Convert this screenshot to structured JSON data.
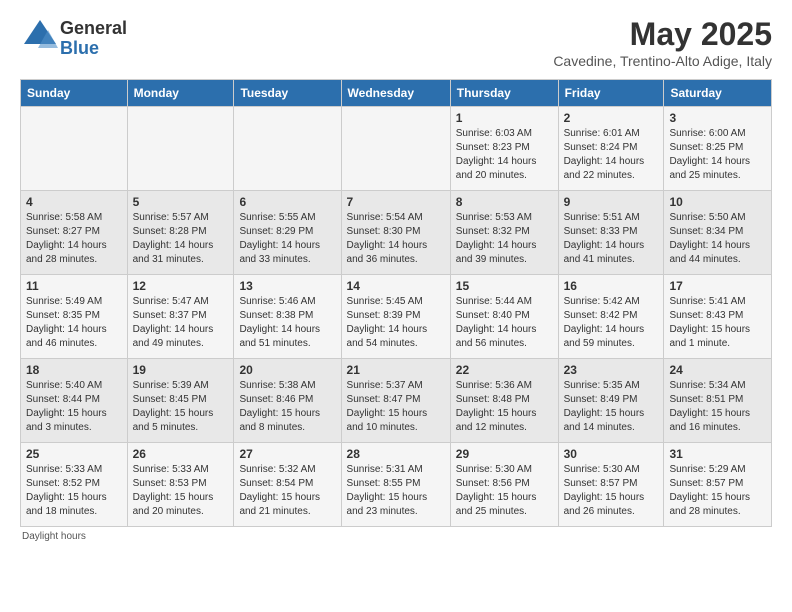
{
  "logo": {
    "general": "General",
    "blue": "Blue"
  },
  "title": "May 2025",
  "subtitle": "Cavedine, Trentino-Alto Adige, Italy",
  "days_of_week": [
    "Sunday",
    "Monday",
    "Tuesday",
    "Wednesday",
    "Thursday",
    "Friday",
    "Saturday"
  ],
  "footer_note": "Daylight hours",
  "weeks": [
    [
      {
        "day": "",
        "info": ""
      },
      {
        "day": "",
        "info": ""
      },
      {
        "day": "",
        "info": ""
      },
      {
        "day": "",
        "info": ""
      },
      {
        "day": "1",
        "info": "Sunrise: 6:03 AM\nSunset: 8:23 PM\nDaylight: 14 hours\nand 20 minutes."
      },
      {
        "day": "2",
        "info": "Sunrise: 6:01 AM\nSunset: 8:24 PM\nDaylight: 14 hours\nand 22 minutes."
      },
      {
        "day": "3",
        "info": "Sunrise: 6:00 AM\nSunset: 8:25 PM\nDaylight: 14 hours\nand 25 minutes."
      }
    ],
    [
      {
        "day": "4",
        "info": "Sunrise: 5:58 AM\nSunset: 8:27 PM\nDaylight: 14 hours\nand 28 minutes."
      },
      {
        "day": "5",
        "info": "Sunrise: 5:57 AM\nSunset: 8:28 PM\nDaylight: 14 hours\nand 31 minutes."
      },
      {
        "day": "6",
        "info": "Sunrise: 5:55 AM\nSunset: 8:29 PM\nDaylight: 14 hours\nand 33 minutes."
      },
      {
        "day": "7",
        "info": "Sunrise: 5:54 AM\nSunset: 8:30 PM\nDaylight: 14 hours\nand 36 minutes."
      },
      {
        "day": "8",
        "info": "Sunrise: 5:53 AM\nSunset: 8:32 PM\nDaylight: 14 hours\nand 39 minutes."
      },
      {
        "day": "9",
        "info": "Sunrise: 5:51 AM\nSunset: 8:33 PM\nDaylight: 14 hours\nand 41 minutes."
      },
      {
        "day": "10",
        "info": "Sunrise: 5:50 AM\nSunset: 8:34 PM\nDaylight: 14 hours\nand 44 minutes."
      }
    ],
    [
      {
        "day": "11",
        "info": "Sunrise: 5:49 AM\nSunset: 8:35 PM\nDaylight: 14 hours\nand 46 minutes."
      },
      {
        "day": "12",
        "info": "Sunrise: 5:47 AM\nSunset: 8:37 PM\nDaylight: 14 hours\nand 49 minutes."
      },
      {
        "day": "13",
        "info": "Sunrise: 5:46 AM\nSunset: 8:38 PM\nDaylight: 14 hours\nand 51 minutes."
      },
      {
        "day": "14",
        "info": "Sunrise: 5:45 AM\nSunset: 8:39 PM\nDaylight: 14 hours\nand 54 minutes."
      },
      {
        "day": "15",
        "info": "Sunrise: 5:44 AM\nSunset: 8:40 PM\nDaylight: 14 hours\nand 56 minutes."
      },
      {
        "day": "16",
        "info": "Sunrise: 5:42 AM\nSunset: 8:42 PM\nDaylight: 14 hours\nand 59 minutes."
      },
      {
        "day": "17",
        "info": "Sunrise: 5:41 AM\nSunset: 8:43 PM\nDaylight: 15 hours\nand 1 minute."
      }
    ],
    [
      {
        "day": "18",
        "info": "Sunrise: 5:40 AM\nSunset: 8:44 PM\nDaylight: 15 hours\nand 3 minutes."
      },
      {
        "day": "19",
        "info": "Sunrise: 5:39 AM\nSunset: 8:45 PM\nDaylight: 15 hours\nand 5 minutes."
      },
      {
        "day": "20",
        "info": "Sunrise: 5:38 AM\nSunset: 8:46 PM\nDaylight: 15 hours\nand 8 minutes."
      },
      {
        "day": "21",
        "info": "Sunrise: 5:37 AM\nSunset: 8:47 PM\nDaylight: 15 hours\nand 10 minutes."
      },
      {
        "day": "22",
        "info": "Sunrise: 5:36 AM\nSunset: 8:48 PM\nDaylight: 15 hours\nand 12 minutes."
      },
      {
        "day": "23",
        "info": "Sunrise: 5:35 AM\nSunset: 8:49 PM\nDaylight: 15 hours\nand 14 minutes."
      },
      {
        "day": "24",
        "info": "Sunrise: 5:34 AM\nSunset: 8:51 PM\nDaylight: 15 hours\nand 16 minutes."
      }
    ],
    [
      {
        "day": "25",
        "info": "Sunrise: 5:33 AM\nSunset: 8:52 PM\nDaylight: 15 hours\nand 18 minutes."
      },
      {
        "day": "26",
        "info": "Sunrise: 5:33 AM\nSunset: 8:53 PM\nDaylight: 15 hours\nand 20 minutes."
      },
      {
        "day": "27",
        "info": "Sunrise: 5:32 AM\nSunset: 8:54 PM\nDaylight: 15 hours\nand 21 minutes."
      },
      {
        "day": "28",
        "info": "Sunrise: 5:31 AM\nSunset: 8:55 PM\nDaylight: 15 hours\nand 23 minutes."
      },
      {
        "day": "29",
        "info": "Sunrise: 5:30 AM\nSunset: 8:56 PM\nDaylight: 15 hours\nand 25 minutes."
      },
      {
        "day": "30",
        "info": "Sunrise: 5:30 AM\nSunset: 8:57 PM\nDaylight: 15 hours\nand 26 minutes."
      },
      {
        "day": "31",
        "info": "Sunrise: 5:29 AM\nSunset: 8:57 PM\nDaylight: 15 hours\nand 28 minutes."
      }
    ]
  ]
}
